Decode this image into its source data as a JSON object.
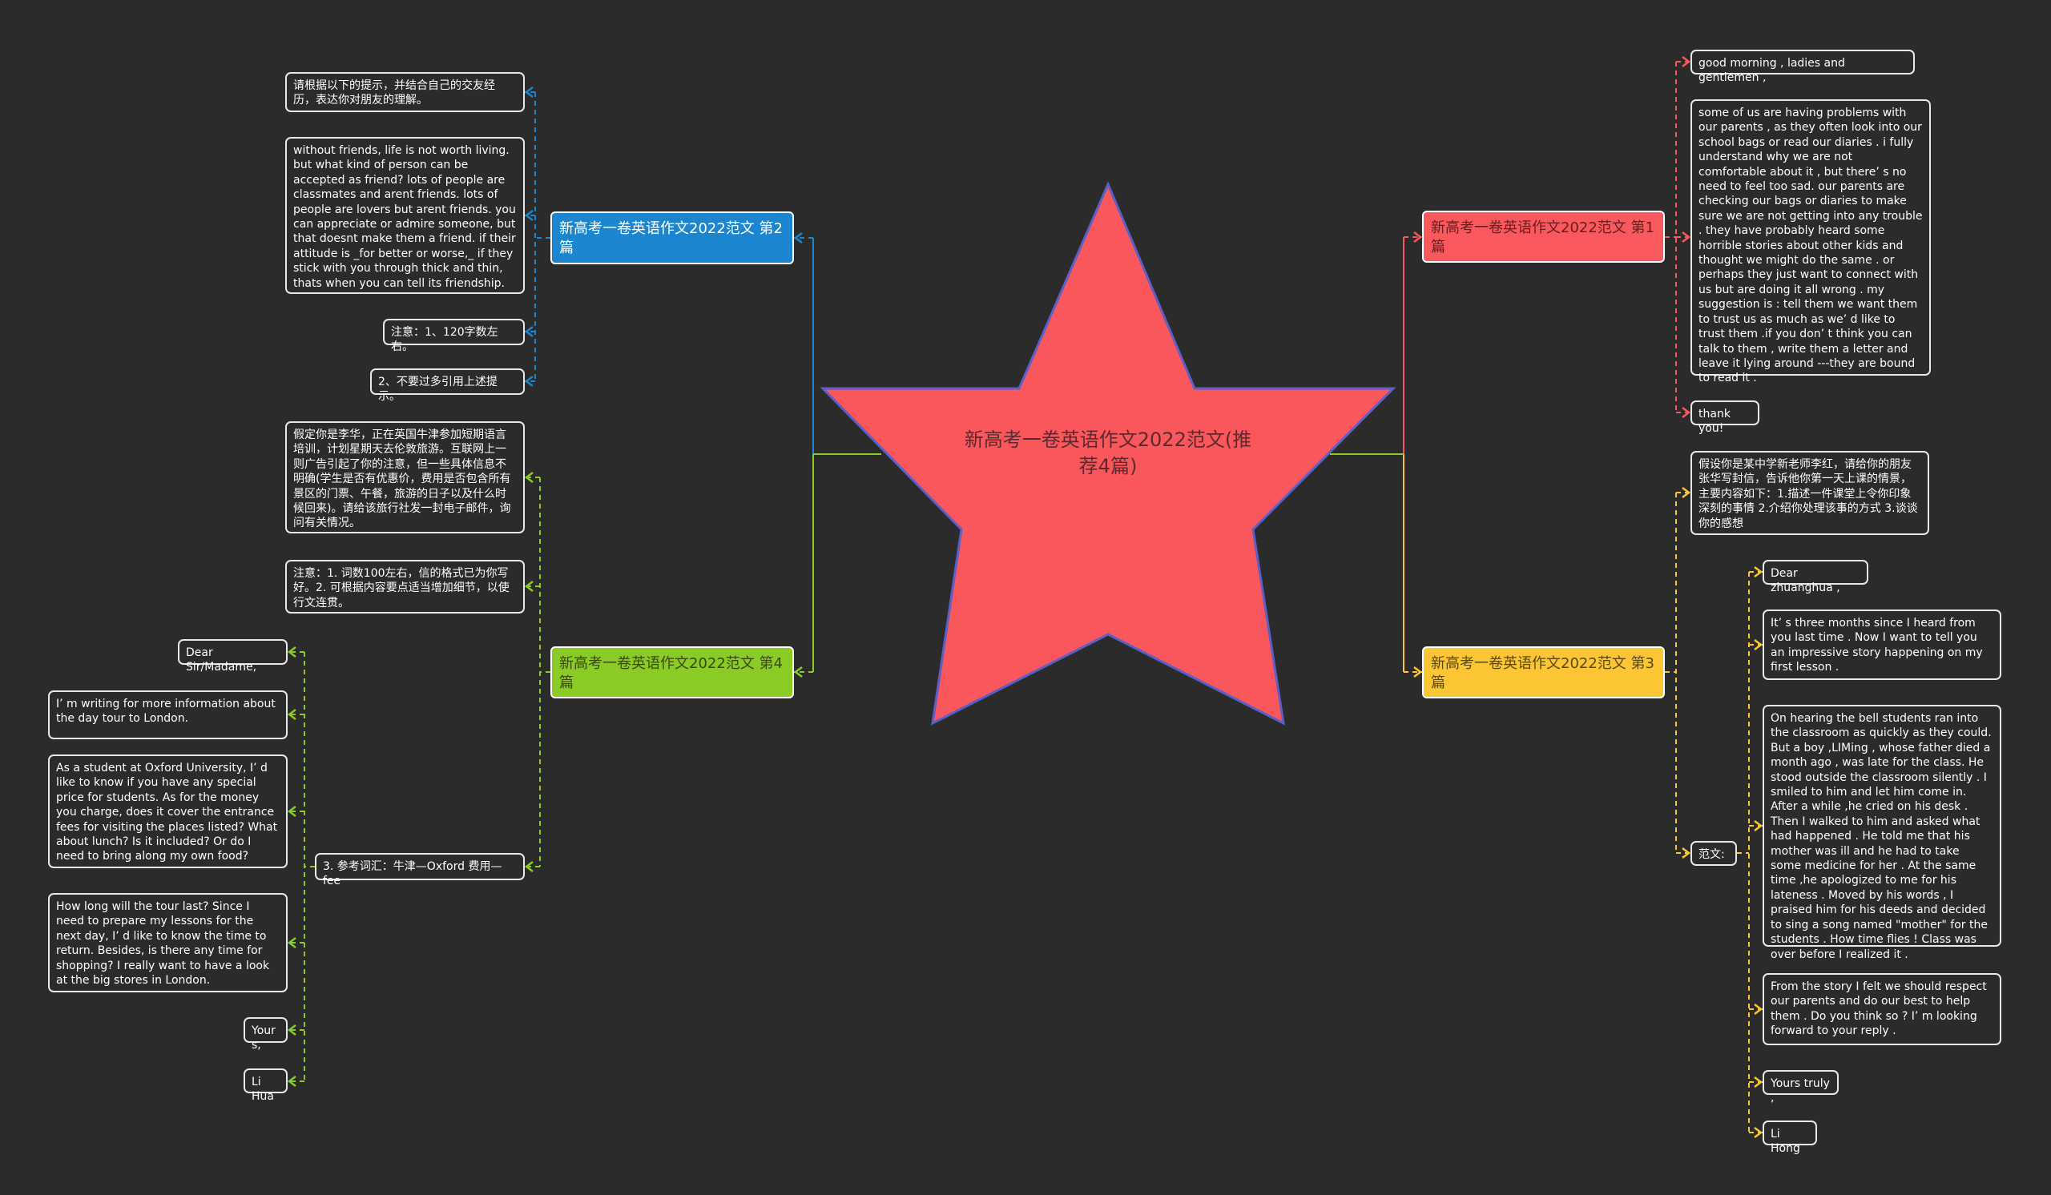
{
  "center": {
    "title": "新高考一卷英语作文2022范文(推荐4篇)",
    "fill": "#f9575c",
    "stroke": "#5b5fc7"
  },
  "branches": {
    "b2": {
      "label": "新高考一卷英语作文2022范文 第2篇",
      "color": "#1b86cf",
      "items": [
        "请根据以下的提示，并结合自己的交友经历，表达你对朋友的理解。",
        "without friends, life is not worth living. but what kind of person can be accepted as friend? lots of people are classmates and arent friends. lots of people are lovers but arent friends. you can appreciate or admire someone, but that doesnt make them a friend. if their attitude is _for better or worse,_ if they stick with you through thick and thin, thats when you can tell its friendship.",
        "注意：1、120字数左右。",
        "2、不要过多引用上述提示。"
      ]
    },
    "b4": {
      "label": "新高考一卷英语作文2022范文 第4篇",
      "color": "#8acb25",
      "items": [
        "假定你是李华，正在英国牛津参加短期语言培训，计划星期天去伦敦旅游。互联网上一则广告引起了你的注意，但一些具体信息不明确(学生是否有优惠价，费用是否包含所有景区的门票、午餐，旅游的日子以及什么时候回来)。请给该旅行社发一封电子邮件，询问有关情况。",
        "注意：1. 词数100左右，信的格式已为你写好。2. 可根据内容要点适当增加细节，以使行文连贯。",
        "3. 参考词汇：牛津—Oxford 费用—fee"
      ],
      "letter": [
        "Dear Sir/Madame,",
        "I’ m writing for more information about the day tour to London.",
        "As a student at Oxford University, I’ d like to know if you have any special price for students. As for the money you charge, does it cover the entrance fees for visiting the places listed? What about lunch? Is it included? Or do I need to bring along my own food?",
        "How long will the tour last? Since I need to prepare my lessons for the next day, I’ d like to know the time to return. Besides, is there any time for shopping? I really want to have a look at the big stores in London.",
        "Yours,",
        "Li Hua"
      ]
    },
    "b1": {
      "label": "新高考一卷英语作文2022范文 第1篇",
      "color": "#f9585d",
      "items": [
        "good morning , ladies and gentlemen ,",
        "some of us are having problems with our parents , as they often look into our school bags or read our diaries . i fully understand why we are not comfortable about it , but there’ s no need to feel too  sad. our parents are checking our bags or diaries to make sure we are not getting into any trouble . they have probably heard some horrible stories about other kids and thought we might do the same . or perhaps they just want to connect with us but are doing it all wrong . my suggestion is : tell them we want them to trust us as much as we’ d like to trust them .if you don’ t think you  can talk to them , write them a letter and  leave it lying around ---they are bound to read it .",
        "thank you!"
      ]
    },
    "b3": {
      "label": "新高考一卷英语作文2022范文 第3篇",
      "color": "#fcc534",
      "items": [
        "假设你是某中学新老师李红，请给你的朋友张华写封信，告诉他你第一天上课的情景，主要内容如下：1.描述一件课堂上令你印象深刻的事情 2.介绍你处理该事的方式 3.谈谈你的感想",
        "范文:"
      ],
      "letter": [
        "Dear zhuanghua ,",
        "It’ s three months since I heard from you  last time . Now I want to tell you an impressive story happening on my first lesson .",
        "On hearing the bell students ran into the classroom as quickly as they could. But a boy ,LIMing , whose father died a month ago , was late for the class. He stood outside the classroom silently . I smiled to him and let him come in. After a while ,he cried on his desk . Then I walked to him and asked what had happened . He told me that his mother was ill and he had to take some medicine for her . At the same time ,he apologized to me for his lateness . Moved by his words , I praised him for his deeds and decided to sing a song named \"mother\" for the students . How time flies ! Class was over before I realized it .",
        "From the story I felt we should respect our parents and do our best to help them  . Do you think so ? I’ m looking forward to your reply .",
        "Yours truly ,",
        "Li Hong"
      ]
    }
  },
  "connector_color": "#8acb25"
}
